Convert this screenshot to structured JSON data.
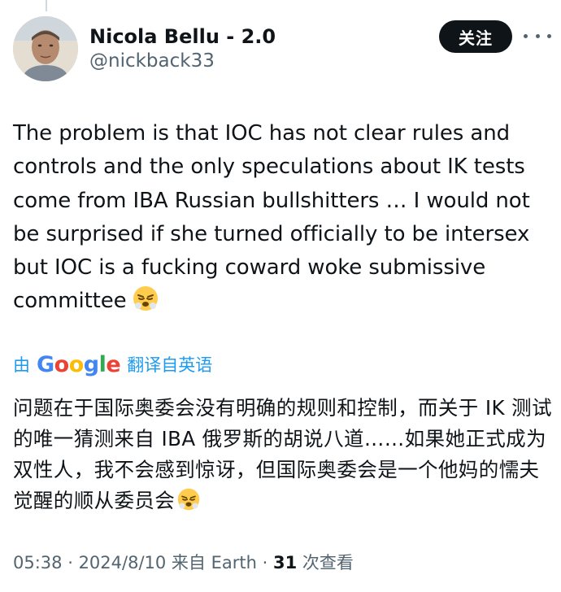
{
  "author": {
    "display_name": "Nicola Bellu - 2.0",
    "handle": "@nickback33"
  },
  "follow_button": {
    "label": "关注"
  },
  "more_menu": {
    "icon": "more-horizontal-icon"
  },
  "tweet": {
    "text": "The problem is that IOC has not clear rules and controls and the only speculations about IK tests come from IBA Russian bullshitters … I would not be surprised if she turned officially to be intersex but IOC is a fucking coward woke submissive committee",
    "emoji": "angry-steam-face-emoji"
  },
  "translation": {
    "prefix": "由",
    "provider_letters": [
      "G",
      "o",
      "o",
      "g",
      "l",
      "e"
    ],
    "suffix": "翻译自英语",
    "text": "问题在于国际奥委会没有明确的规则和控制，而关于 IK 测试的唯一猜测来自 IBA 俄罗斯的胡说八道……如果她正式成为双性人，我不会感到惊讶，但国际奥委会是一个他妈的懦夫觉醒的顺从委员会"
  },
  "meta": {
    "time": "05:38",
    "separator": " · ",
    "date": "2024/8/10",
    "source_prefix": " 来自 ",
    "source": "Earth",
    "views_count": "31",
    "views_label": " 次查看"
  },
  "colors": {
    "accent": "#1d9bf0",
    "text_primary": "#0f1419",
    "text_secondary": "#536471",
    "button_bg": "#0f1419"
  }
}
